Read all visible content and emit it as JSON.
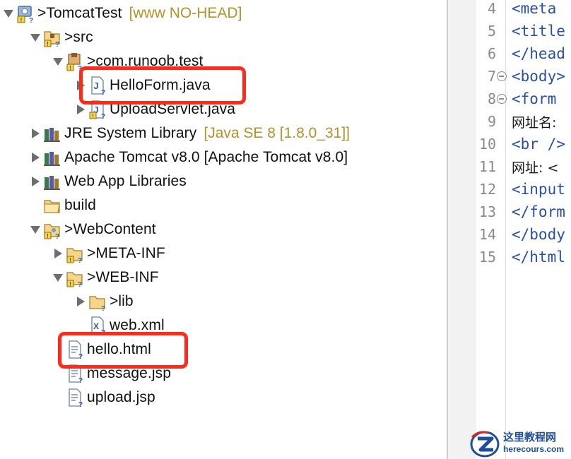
{
  "explorer": {
    "project": {
      "prefix": "> ",
      "name": "TomcatTest",
      "decoration": "[www NO-HEAD]"
    },
    "src": {
      "prefix": "> ",
      "name": "src"
    },
    "package": {
      "prefix": "> ",
      "name": "com.runoob.test"
    },
    "file_helloform": {
      "name": "HelloForm.java"
    },
    "file_uploadservlet": {
      "name": "UploadServlet.java"
    },
    "jre": {
      "name": "JRE System Library",
      "decoration": "[Java SE 8 [1.8.0_31]]"
    },
    "tomcat": {
      "name": "Apache Tomcat v8.0 [Apache Tomcat v8.0]"
    },
    "webapp_libs": {
      "name": "Web App Libraries"
    },
    "build": {
      "name": "build"
    },
    "webcontent": {
      "prefix": "> ",
      "name": "WebContent"
    },
    "metainf": {
      "prefix": "> ",
      "name": "META-INF"
    },
    "webinf": {
      "prefix": "> ",
      "name": "WEB-INF"
    },
    "lib": {
      "prefix": "> ",
      "name": "lib"
    },
    "webxml": {
      "name": "web.xml"
    },
    "hello_html": {
      "name": "hello.html"
    },
    "message_jsp": {
      "name": "message.jsp"
    },
    "upload_jsp": {
      "name": "upload.jsp"
    }
  },
  "editor": {
    "lines": [
      {
        "num": "4",
        "text": "<meta"
      },
      {
        "num": "5",
        "text": "<title"
      },
      {
        "num": "6",
        "text": "</head"
      },
      {
        "num": "7",
        "text": "<body>"
      },
      {
        "num": "8",
        "text": "<form"
      },
      {
        "num": "9",
        "text": "网址名:"
      },
      {
        "num": "10",
        "text": "<br />"
      },
      {
        "num": "11",
        "text": "网址: <"
      },
      {
        "num": "12",
        "text": "<input"
      },
      {
        "num": "13",
        "text": "</form"
      },
      {
        "num": "14",
        "text": "</body"
      },
      {
        "num": "15",
        "text": "</html"
      }
    ]
  },
  "colors": {
    "highlight": "#ff2a1a",
    "tag": "#2a4fa8",
    "decoration": "#b5912a"
  },
  "watermark": {
    "cn": "这里教程网",
    "url": "herecours.com"
  }
}
